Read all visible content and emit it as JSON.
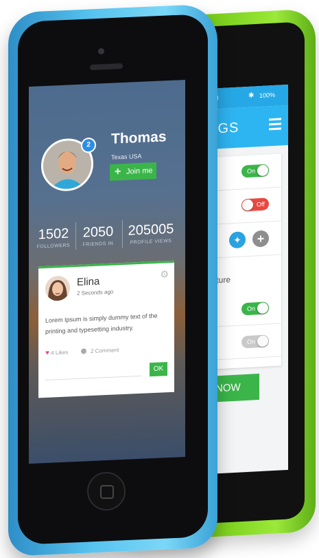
{
  "back_phone": {
    "status": {
      "time": "AM",
      "battery": "100%"
    },
    "header_title": "NGS",
    "rows": [
      {
        "toggle": "On"
      },
      {
        "toggle": "Off"
      }
    ],
    "section_label": "picture",
    "rows2": [
      {
        "toggle": "On"
      },
      {
        "toggle": "On"
      }
    ],
    "action_label": "NOW"
  },
  "front_phone": {
    "profile": {
      "name": "Thomas",
      "location": "Texas USA",
      "badge_count": "2",
      "join_label": "Join me"
    },
    "stats": [
      {
        "value": "1502",
        "label": "FOLLOWERS"
      },
      {
        "value": "2050",
        "label": "FRIENDS IN"
      },
      {
        "value": "205005",
        "label": "PROFILE VIEWS"
      }
    ],
    "post": {
      "author": "Elina",
      "time": "2 Seconds ago",
      "text": "Lorem Ipsum is simply dummy text of the printing and typesetting industry.",
      "likes": "4 Likes",
      "comments": "2 Comment",
      "ok_label": "OK"
    }
  },
  "colors": {
    "accent_green": "#3bb54a",
    "accent_blue": "#2db5f2",
    "phone_blue": "#57c3ef",
    "phone_green": "#7fd21f"
  },
  "icons": [
    "bluetooth-icon",
    "menu-icon",
    "twitter-icon",
    "plus-icon",
    "gear-icon",
    "heart-icon",
    "comment-icon",
    "plus-icon"
  ]
}
